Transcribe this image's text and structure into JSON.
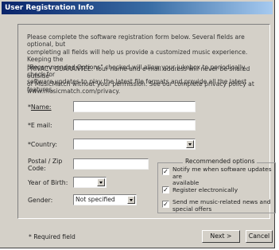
{
  "window": {
    "title": "User Registration Info"
  },
  "intro": {
    "paragraph1_lines": [
      "Please complete the software registration form below. Several fields are optional, but",
      "completing all fields will help us provide a customized music experience. Keeping the",
      "\"Recommended Options\" checked will allow your jukebox to periodically check for",
      "software updates to play the latest file formats and provide all the latest features."
    ],
    "paragraph2_lines": [
      "PRIVACY GUARANTEE: Your name and e-mail address will never be shared outside",
      "of MusicMatch without your permission. See our complete privacy policy at",
      "www.musicmatch.com/privacy."
    ]
  },
  "form": {
    "name": {
      "req": "*",
      "label": "Name:",
      "value": ""
    },
    "email": {
      "req": "*",
      "label": "E mail:",
      "value": ""
    },
    "country": {
      "req": "*",
      "label": "Country:",
      "value": ""
    },
    "postal": {
      "label_line1": "Postal / Zip",
      "label_line2": "Code:",
      "value": ""
    },
    "year_of_birth": {
      "label": "Year of Birth:",
      "value": ""
    },
    "gender": {
      "label": "Gender:",
      "value": "Not specified"
    }
  },
  "recommended": {
    "title": "Recommended options",
    "options": [
      {
        "label_line1": "Notify me when software updates are",
        "label_line2": "available",
        "checked": true,
        "mark": "✓"
      },
      {
        "label_line1": "Register electronically",
        "label_line2": "",
        "checked": true,
        "mark": "✓"
      },
      {
        "label_line1": "Send me music-related news and",
        "label_line2": "special offers",
        "checked": true,
        "mark": "✓"
      }
    ]
  },
  "footer": {
    "required_note": "* Required field",
    "next_label": "Next >",
    "cancel_label": "Cancel"
  }
}
